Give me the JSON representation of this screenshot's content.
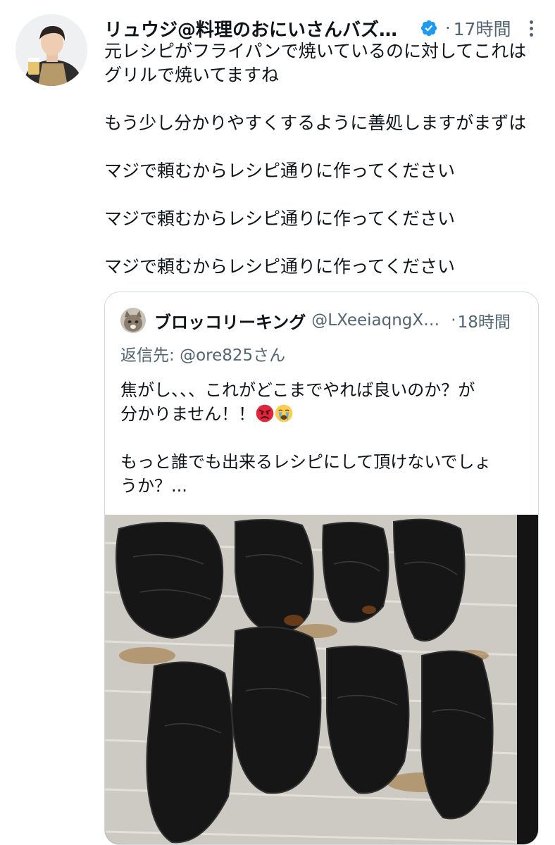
{
  "post": {
    "author_name": "リュウジ@料理のおにいさんバズレ...",
    "time": "17時間",
    "dot": "·",
    "text": "元レシピがフライパンで焼いているのに対してこれは\nグリルで焼いてますね\n\nもう少し分かりやすくするように善処しますがまずは\n\nマジで頼むからレシピ通りに作ってください\n\nマジで頼むからレシピ通りに作ってください\n\nマジで頼むからレシピ通りに作ってください"
  },
  "quote": {
    "author_name": "ブロッコリーキング",
    "handle": "@LXeeiaqngXv...",
    "dot": "·",
    "time": "18時間",
    "reply_prefix": "返信先: ",
    "reply_user": "@ore825さん",
    "text_line1": "焦がし、、、これがどこまでやれば良いのか？が",
    "text_line2": "分かりません！！",
    "text_rest": "もっと誰でも出来るレシピにして頂けないでしょ\nうか？..."
  },
  "icons": {
    "verified": "verified-badge-icon",
    "more": "more-options-icon",
    "angry": "angry-face-emoji",
    "crying": "crying-face-emoji"
  },
  "colors": {
    "text": "#0f1419",
    "secondary": "#536471",
    "verified": "#1d9bf0",
    "border": "#cfd9de"
  }
}
